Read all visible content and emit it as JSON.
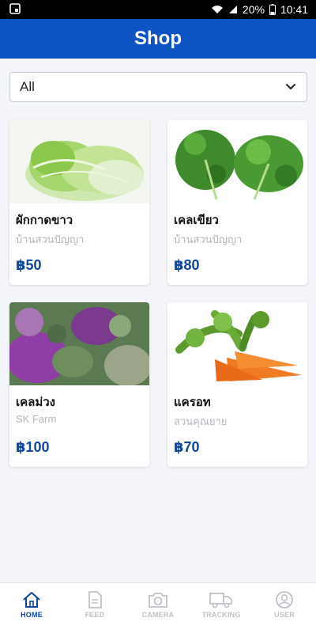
{
  "status_bar": {
    "battery": "20%",
    "time": "10:41"
  },
  "header": {
    "title": "Shop"
  },
  "filter": {
    "selected": "All"
  },
  "products": [
    {
      "name": "ผักกาดขาว",
      "seller": "บ้านสวนปัญญา",
      "price": "฿50"
    },
    {
      "name": "เคลเขียว",
      "seller": "บ้านสวนปัญญา",
      "price": "฿80"
    },
    {
      "name": "เคลม่วง",
      "seller": "SK Farm",
      "price": "฿100"
    },
    {
      "name": "แครอท",
      "seller": "สวนคุณยาย",
      "price": "฿70"
    }
  ],
  "bottom_nav": {
    "items": [
      {
        "label": "HOME",
        "icon": "home-icon",
        "active": true
      },
      {
        "label": "FEED",
        "icon": "document-icon",
        "active": false
      },
      {
        "label": "CAMERA",
        "icon": "camera-icon",
        "active": false
      },
      {
        "label": "TRACKING",
        "icon": "truck-icon",
        "active": false
      },
      {
        "label": "USER",
        "icon": "user-icon",
        "active": false
      }
    ]
  },
  "colors": {
    "brand": "#0d53c4",
    "price": "#0d47a1",
    "background": "#f3f5fb",
    "inactive": "#bfc2c8"
  }
}
